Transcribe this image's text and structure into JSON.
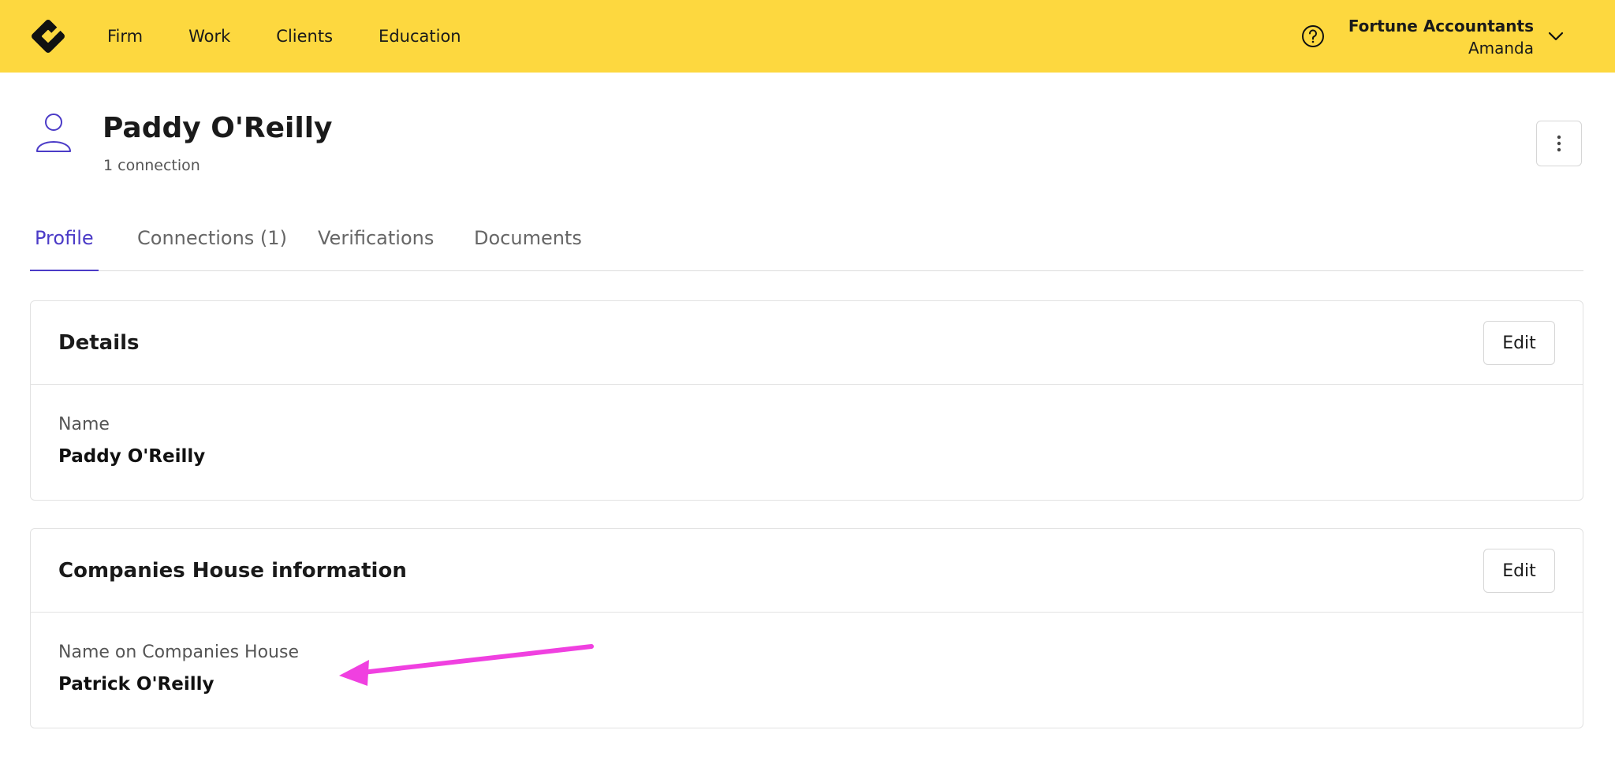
{
  "header": {
    "nav": [
      "Firm",
      "Work",
      "Clients",
      "Education"
    ],
    "account": {
      "firm": "Fortune Accountants",
      "user": "Amanda"
    },
    "icons": {
      "logo": "diamond-logo-icon",
      "help": "question-circle-icon",
      "chevron": "chevron-down-icon"
    },
    "background_color": "#fdd83f"
  },
  "client": {
    "name": "Paddy O'Reilly",
    "subtitle": "1 connection",
    "icon": "person-icon",
    "accent_color": "#4b3bc7"
  },
  "tabs": [
    {
      "label": "Profile",
      "active": true
    },
    {
      "label": "Connections (1)",
      "active": false
    },
    {
      "label": "Verifications",
      "active": false
    },
    {
      "label": "Documents",
      "active": false
    }
  ],
  "details_card": {
    "title": "Details",
    "edit_label": "Edit",
    "field_label": "Name",
    "field_value": "Paddy O'Reilly"
  },
  "companies_card": {
    "title": "Companies House information",
    "edit_label": "Edit",
    "field_label": "Name on Companies House",
    "field_value": "Patrick O'Reilly"
  },
  "annotation": {
    "type": "arrow",
    "color": "#f040e0"
  }
}
